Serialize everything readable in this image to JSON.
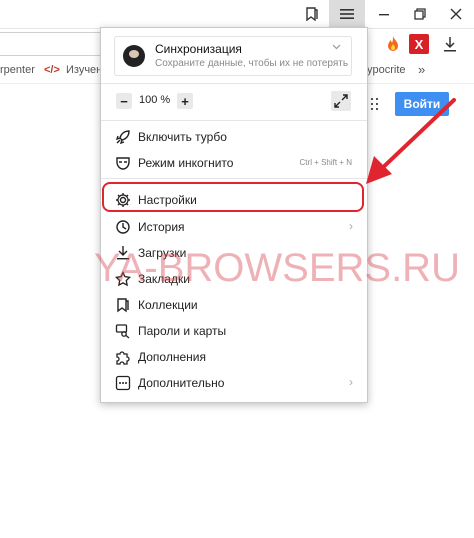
{
  "bookmarks": {
    "items": [
      {
        "label": "rpenter"
      },
      {
        "label": "Изучен"
      },
      {
        "label": "ypocrite"
      }
    ],
    "more": "»"
  },
  "page": {
    "login_label": "Войти"
  },
  "menu": {
    "sync": {
      "title": "Синхронизация",
      "subtitle": "Сохраните данные, чтобы их не потерять"
    },
    "zoom": {
      "minus": "−",
      "value": "100 %",
      "plus": "+"
    },
    "items": [
      {
        "label": "Включить турбо",
        "icon": "rocket-icon"
      },
      {
        "label": "Режим инкогнито",
        "icon": "incognito-mask-icon",
        "shortcut": "Ctrl + Shift + N"
      },
      {
        "label": "Настройки",
        "icon": "gear-icon"
      },
      {
        "label": "История",
        "icon": "clock-icon",
        "chevron": "›"
      },
      {
        "label": "Загрузки",
        "icon": "download-icon"
      },
      {
        "label": "Закладки",
        "icon": "star-icon"
      },
      {
        "label": "Коллекции",
        "icon": "collections-icon"
      },
      {
        "label": "Пароли и карты",
        "icon": "key-card-icon"
      },
      {
        "label": "Дополнения",
        "icon": "puzzle-icon"
      },
      {
        "label": "Дополнительно",
        "icon": "more-dots-icon",
        "chevron": "›"
      }
    ]
  },
  "watermark": "YA-BROWSERS.RU",
  "colors": {
    "highlight": "#e0252f",
    "arrow": "#e0252f",
    "login_button": "#3f8ef2"
  }
}
